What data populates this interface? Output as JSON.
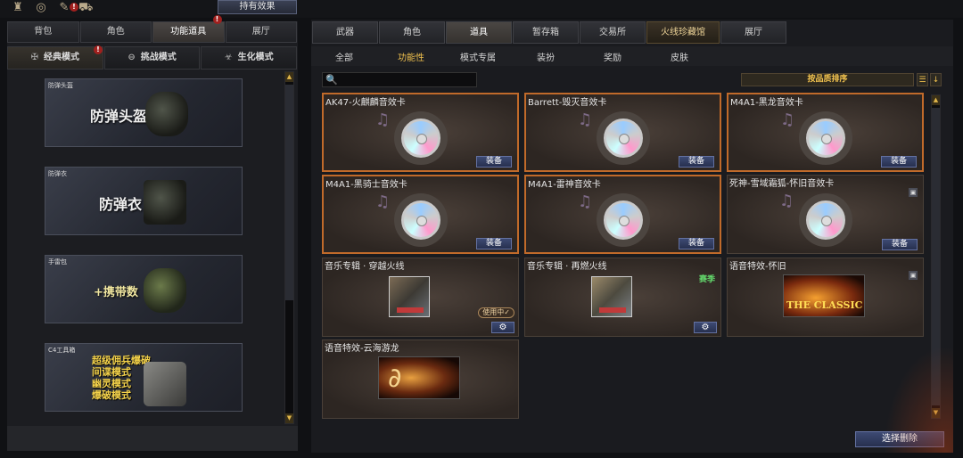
{
  "topbar": {
    "icons": [
      "trophy-icon",
      "badge-icon",
      "item-icon",
      "bag-icon"
    ],
    "alert_mark": "!",
    "hold_effects_label": "持有效果"
  },
  "left": {
    "tabs": [
      "背包",
      "角色",
      "功能道具",
      "展厅"
    ],
    "active_tab": "功能道具",
    "modes": [
      {
        "label": "经典模式",
        "icon": "crossed-guns-icon"
      },
      {
        "label": "挑战模式",
        "icon": "challenge-icon"
      },
      {
        "label": "生化模式",
        "icon": "biohazard-icon"
      }
    ],
    "cards": [
      {
        "caption": "防弹头盔",
        "big_text": "防弹头盔"
      },
      {
        "caption": "防弹衣",
        "big_text": "防弹衣"
      },
      {
        "caption": "手雷包",
        "big_text": "+携带数"
      },
      {
        "caption": "C4工具箱",
        "lines": [
          "超级佣兵爆破",
          "间谍模式",
          "幽灵模式",
          "爆破模式"
        ]
      }
    ]
  },
  "right": {
    "tabs": [
      "武器",
      "角色",
      "道具",
      "暂存箱",
      "交易所",
      "火线珍藏馆",
      "展厅"
    ],
    "active_tab": "道具",
    "subtabs": [
      "全部",
      "功能性",
      "模式专属",
      "装扮",
      "奖励",
      "皮肤"
    ],
    "active_subtab": "功能性",
    "search_placeholder": "",
    "sort_label": "按品质排序",
    "items": [
      {
        "title": "AK47-火麒麟音效卡",
        "button": "装备",
        "selected": true
      },
      {
        "title": "Barrett-毁灭音效卡",
        "button": "装备",
        "selected": true
      },
      {
        "title": "M4A1-黑龙音效卡",
        "button": "装备",
        "selected": true
      },
      {
        "title": "M4A1-黑骑士音效卡",
        "button": "装备",
        "selected": true
      },
      {
        "title": "M4A1-雷神音效卡",
        "button": "装备",
        "selected": true
      },
      {
        "title": "死神-雪域霜狐-怀旧音效卡",
        "button": "装备",
        "selected": false
      },
      {
        "title": "音乐专辑 · 穿越火线",
        "status": "使用中✓",
        "selected": false
      },
      {
        "title": "音乐专辑 · 再燃火线",
        "tag": "赛季",
        "selected": false
      },
      {
        "title": "语音特效-怀旧",
        "banner_text": "THE CLASSIC",
        "selected": false
      },
      {
        "title": "语音特效-云海游龙",
        "selected": false
      }
    ],
    "delete_label": "选择删除"
  }
}
